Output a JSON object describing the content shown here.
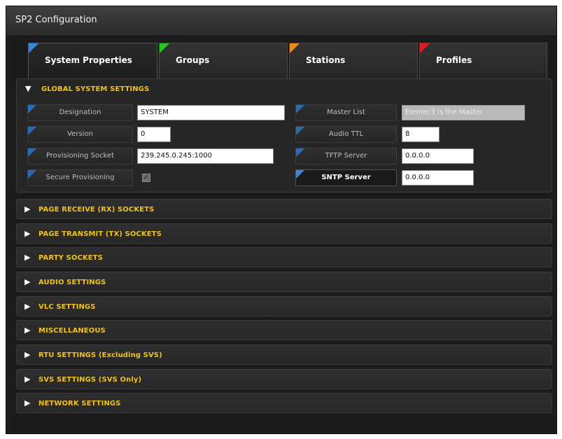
{
  "window": {
    "title": "SP2 Configuration"
  },
  "tabs": [
    {
      "label": "System Properties",
      "color": "#2e8ae6",
      "active": true
    },
    {
      "label": "Groups",
      "color": "#23c71f",
      "active": false
    },
    {
      "label": "Stations",
      "color": "#f08a17",
      "active": false
    },
    {
      "label": "Profiles",
      "color": "#e01d1d",
      "active": false
    }
  ],
  "global": {
    "title": "GLOBAL SYSTEM SETTINGS",
    "expanded_icon": "triangle-down-icon",
    "designation": {
      "label": "Designation",
      "value": "SYSTEM"
    },
    "version": {
      "label": "Version",
      "value": "0"
    },
    "provisioning_socket": {
      "label": "Provisioning Socket",
      "value": "239.245.0.245:1000"
    },
    "secure_provisioning": {
      "label": "Secure Provisioning",
      "checked": true
    },
    "master_list": {
      "label": "Master List",
      "value": "Elemec3 is the Master"
    },
    "audio_ttl": {
      "label": "Audio TTL",
      "value": "8"
    },
    "tftp_server": {
      "label": "TFTP Server",
      "value": "0.0.0.0"
    },
    "sntp_server": {
      "label": "SNTP Server",
      "value": "0.0.0.0"
    }
  },
  "sections": [
    "PAGE RECEIVE (RX) SOCKETS",
    "PAGE TRANSMIT (TX) SOCKETS",
    "PARTY SOCKETS",
    "AUDIO SETTINGS",
    "VLC SETTINGS",
    "MISCELLANEOUS",
    "RTU SETTINGS (Excluding SVS)",
    "SVS SETTINGS (SVS Only)",
    "NETWORK SETTINGS"
  ],
  "colors": {
    "section_title": "#f2c21b",
    "accent": "#2e8ae6"
  },
  "icons": {
    "collapsed": "triangle-right-icon",
    "check": "checkmark-icon"
  }
}
